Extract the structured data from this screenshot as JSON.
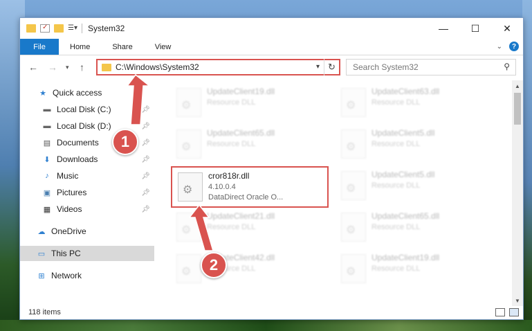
{
  "window": {
    "title": "System32"
  },
  "ribbon": {
    "file": "File",
    "home": "Home",
    "share": "Share",
    "view": "View"
  },
  "address": {
    "path": "C:\\Windows\\System32",
    "search_placeholder": "Search System32"
  },
  "nav": {
    "quick_access": "Quick access",
    "items": [
      {
        "label": "Local Disk (C:)",
        "icon": "drive-icon",
        "pinned": true
      },
      {
        "label": "Local Disk (D:)",
        "icon": "drive-icon",
        "pinned": true
      },
      {
        "label": "Documents",
        "icon": "documents-icon",
        "pinned": true
      },
      {
        "label": "Downloads",
        "icon": "downloads-icon",
        "pinned": true
      },
      {
        "label": "Music",
        "icon": "music-icon",
        "pinned": true
      },
      {
        "label": "Pictures",
        "icon": "pictures-icon",
        "pinned": true
      },
      {
        "label": "Videos",
        "icon": "videos-icon",
        "pinned": true
      }
    ],
    "onedrive": "OneDrive",
    "this_pc": "This PC",
    "network": "Network"
  },
  "files": [
    {
      "name": "UpdateClient19.dll",
      "desc": "Resource DLL"
    },
    {
      "name": "UpdateClient63.dll",
      "desc": "Resource DLL"
    },
    {
      "name": "UpdateClient65.dll",
      "desc": "Resource DLL"
    },
    {
      "name": "UpdateClient5.dll",
      "desc": "Resource DLL"
    },
    {
      "name": "cror818r.dll",
      "version": "4.10.0.4",
      "desc": "DataDirect Oracle O..."
    },
    {
      "name": "UpdateClient5.dll",
      "desc": "Resource DLL"
    },
    {
      "name": "UpdateClient21.dll",
      "desc": "Resource DLL"
    },
    {
      "name": "UpdateClient65.dll",
      "desc": "Resource DLL"
    },
    {
      "name": "UpdateClient42.dll",
      "desc": "Resource DLL"
    },
    {
      "name": "UpdateClient19.dll",
      "desc": "Resource DLL"
    }
  ],
  "status": {
    "count": "118 items"
  },
  "callouts": {
    "one": "1",
    "two": "2"
  },
  "colors": {
    "accent": "#1979ca",
    "highlight": "#d9534f"
  }
}
